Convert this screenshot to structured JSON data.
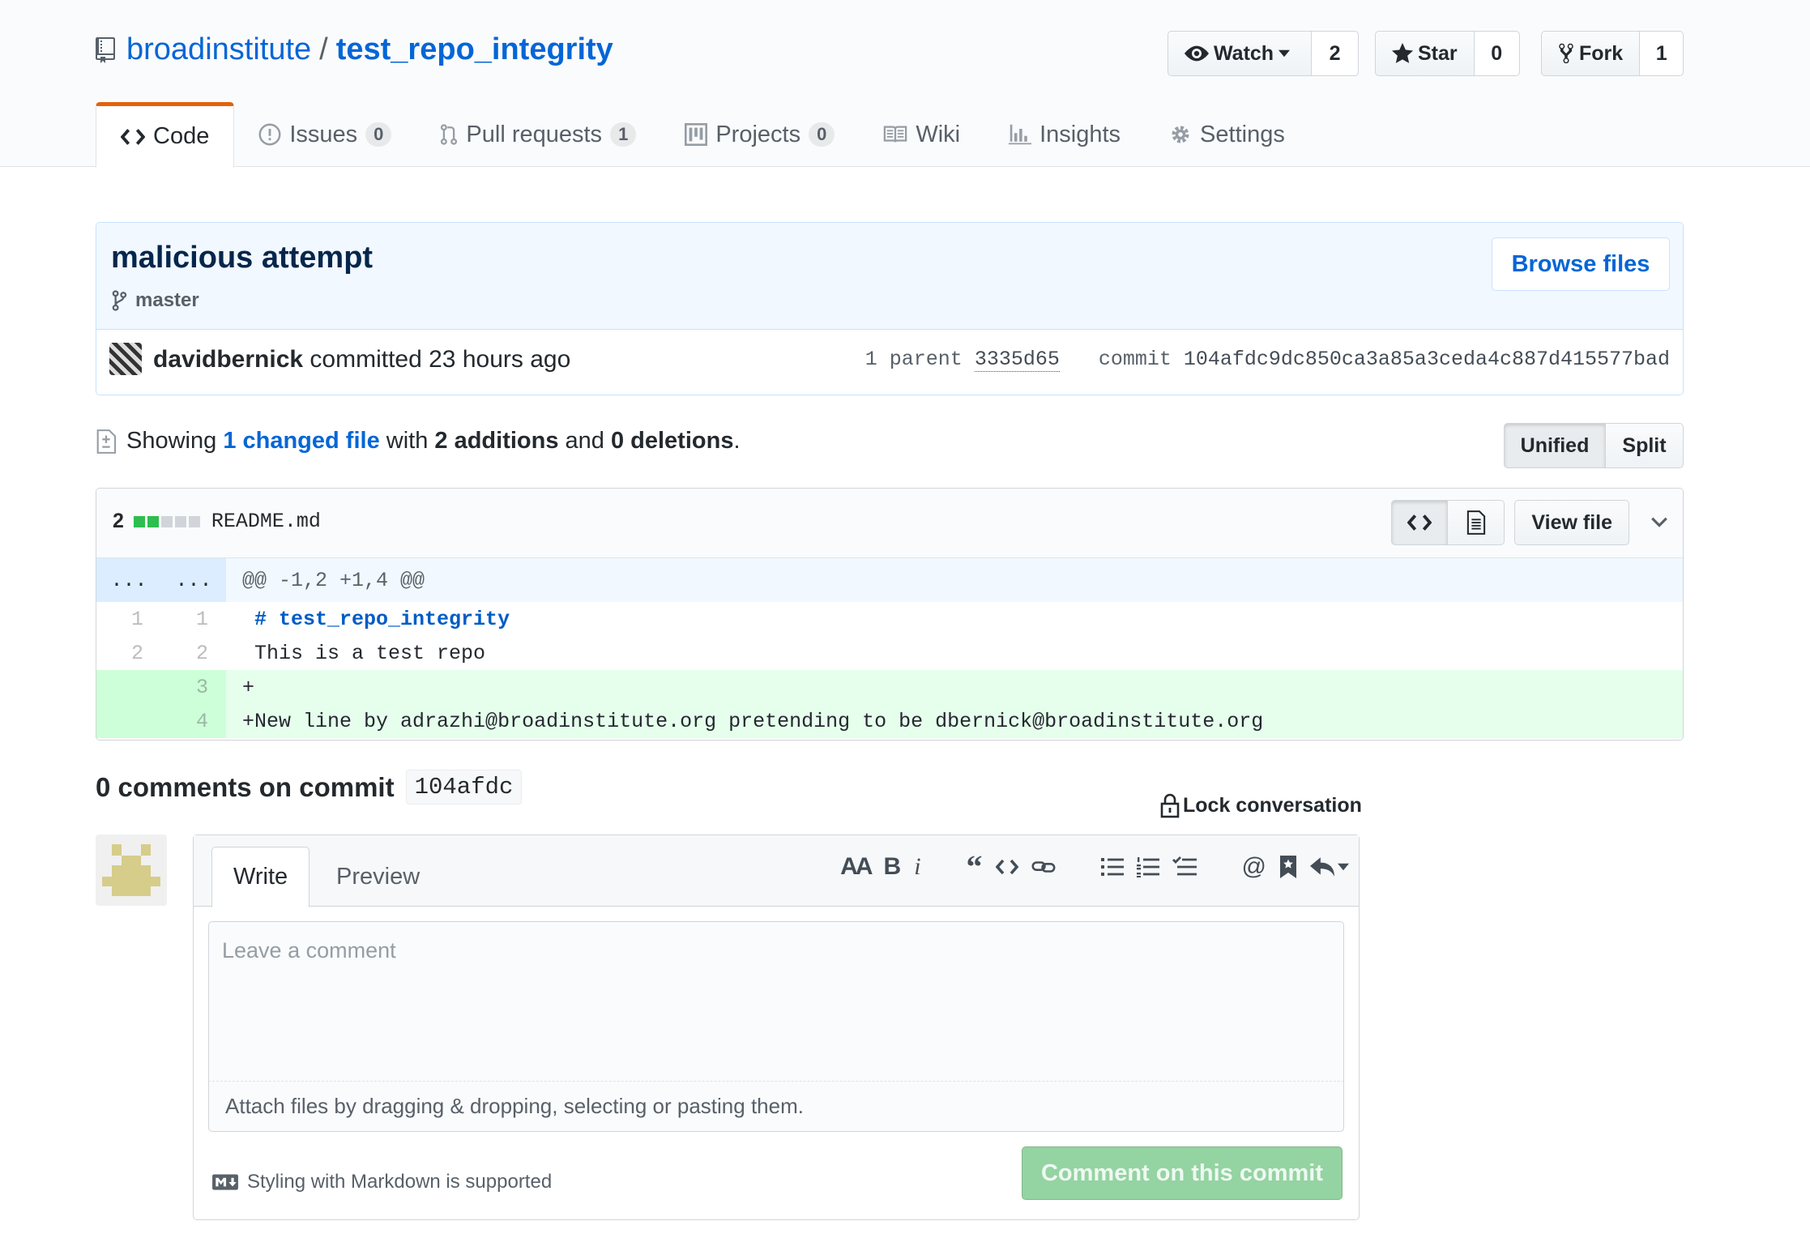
{
  "repo": {
    "owner": "broadinstitute",
    "separator": "/",
    "name": "test_repo_integrity"
  },
  "actions": {
    "watch": {
      "label": "Watch",
      "count": "2"
    },
    "star": {
      "label": "Star",
      "count": "0"
    },
    "fork": {
      "label": "Fork",
      "count": "1"
    }
  },
  "tabs": [
    {
      "label": "Code",
      "counter": null
    },
    {
      "label": "Issues",
      "counter": "0"
    },
    {
      "label": "Pull requests",
      "counter": "1"
    },
    {
      "label": "Projects",
      "counter": "0"
    },
    {
      "label": "Wiki",
      "counter": null
    },
    {
      "label": "Insights",
      "counter": null
    },
    {
      "label": "Settings",
      "counter": null
    }
  ],
  "commit": {
    "title": "malicious attempt",
    "branch": "master",
    "browse_label": "Browse files",
    "author": "davidbernick",
    "committed_text": "committed 23 hours ago",
    "parent_label": "1 parent",
    "parent_sha": "3335d65",
    "commit_label": "commit",
    "sha": "104afdc9dc850ca3a85a3ceda4c887d415577bad"
  },
  "toc": {
    "showing": "Showing ",
    "changed_files": "1 changed file",
    "with": " with ",
    "additions": "2 additions",
    "and": " and ",
    "deletions": "0 deletions",
    "end": ".",
    "unified": "Unified",
    "split": "Split"
  },
  "file": {
    "changes": "2",
    "diffstat": [
      "added",
      "added",
      "neutral",
      "neutral",
      "neutral"
    ],
    "name": "README.md",
    "view_file": "View file",
    "hunk_left": "...",
    "hunk_right": "...",
    "hunk_header": "@@ -1,2 +1,4 @@",
    "lines": [
      {
        "old": "1",
        "new": "1",
        "marker": " ",
        "text": "# test_repo_integrity",
        "type": "context-heading"
      },
      {
        "old": "2",
        "new": "2",
        "marker": " ",
        "text": "This is a test repo",
        "type": "context"
      },
      {
        "old": "",
        "new": "3",
        "marker": "+",
        "text": "",
        "type": "add"
      },
      {
        "old": "",
        "new": "4",
        "marker": "+",
        "text": "New line by adrazhi@broadinstitute.org pretending to be dbernick@broadinstitute.org",
        "type": "add"
      }
    ]
  },
  "comments": {
    "heading": "0 comments on commit",
    "sha_short": "104afdc",
    "lock_label": "Lock conversation",
    "write_tab": "Write",
    "preview_tab": "Preview",
    "placeholder": "Leave a comment",
    "attach_text": "Attach files by dragging & dropping, selecting or pasting them.",
    "markdown_note": "Styling with Markdown is supported",
    "submit_label": "Comment on this commit"
  },
  "colors": {
    "link": "#0366d6",
    "tab_accent": "#e36209",
    "diff_add": "#e6ffed",
    "diffstat_added": "#2cbe4e",
    "diffstat_neutral": "#d1d5da",
    "submit_disabled": "#94d3a2"
  }
}
